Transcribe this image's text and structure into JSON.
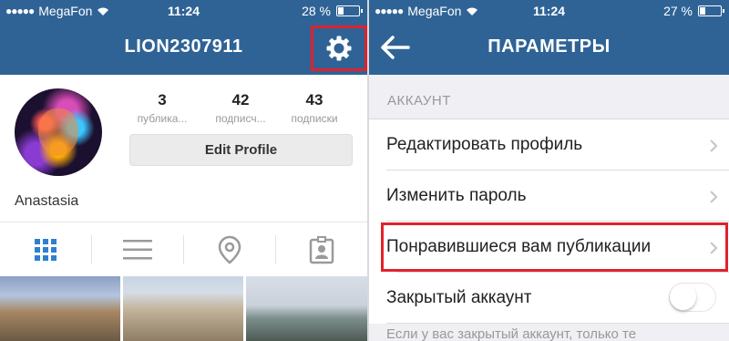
{
  "left": {
    "status": {
      "carrier": "MegaFon",
      "time": "11:24",
      "battery_text": "28 %",
      "battery_level": 0.28
    },
    "nav": {
      "title": "LION2307911"
    },
    "profile": {
      "stats": [
        {
          "num": "3",
          "label": "публика..."
        },
        {
          "num": "42",
          "label": "подписч..."
        },
        {
          "num": "43",
          "label": "подписки"
        }
      ],
      "edit_button": "Edit Profile",
      "name": "Anastasia"
    },
    "tabs": [
      "grid-icon",
      "list-icon",
      "location-pin-icon",
      "tagged-person-icon"
    ]
  },
  "right": {
    "status": {
      "carrier": "MegaFon",
      "time": "11:24",
      "battery_text": "27 %",
      "battery_level": 0.27
    },
    "nav": {
      "title": "ПАРАМЕТРЫ"
    },
    "section_header": "АККАУНТ",
    "rows": [
      {
        "label": "Редактировать профиль"
      },
      {
        "label": "Изменить пароль"
      },
      {
        "label": "Понравившиеся вам публикации"
      },
      {
        "label": "Закрытый аккаунт",
        "toggle": false
      }
    ],
    "footer_note": "Если у вас закрытый аккаунт, только те"
  },
  "colors": {
    "nav_bg": "#2f6396",
    "highlight": "#e0222d"
  }
}
